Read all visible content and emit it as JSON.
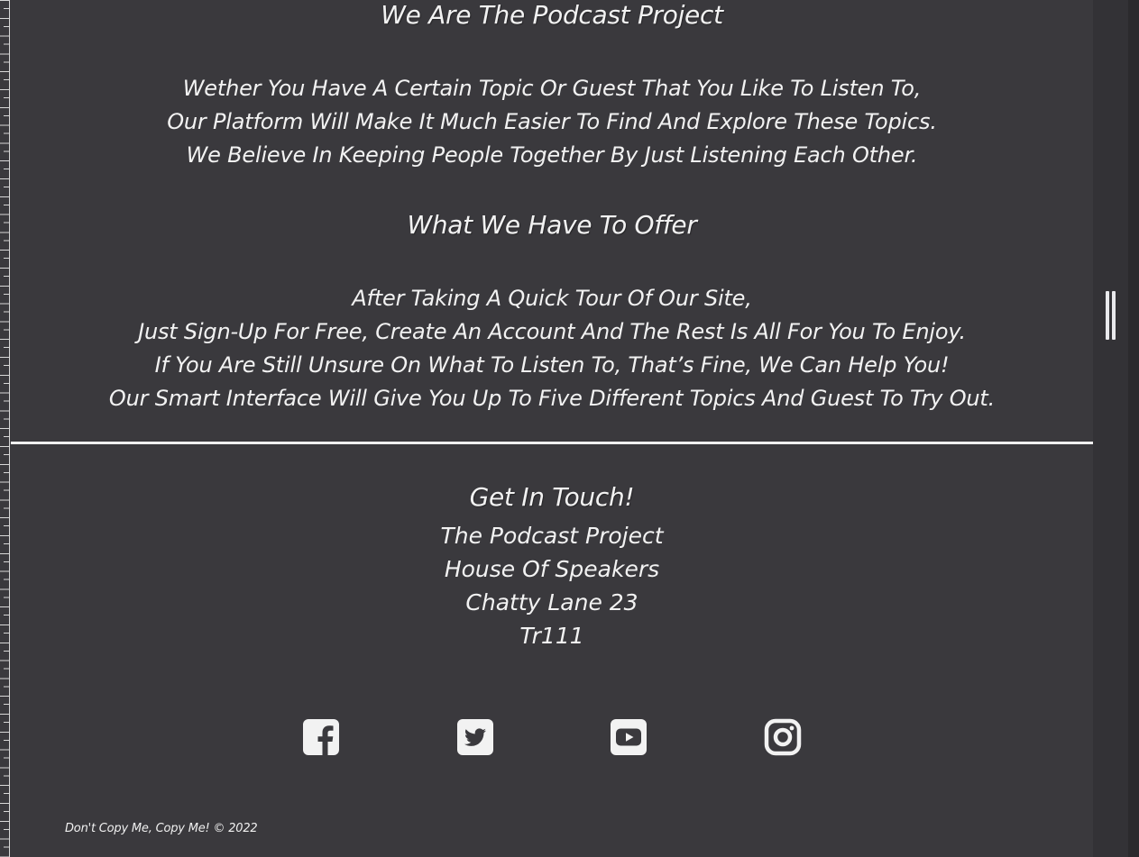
{
  "about": {
    "title": "We Are The Podcast Project",
    "lines": [
      "Wether You Have A Certain Topic Or Guest That You Like To Listen To,",
      "Our Platform Will Make It Much Easier To Find And Explore These Topics.",
      "We Believe In Keeping People Together By Just Listening Each Other."
    ]
  },
  "offer": {
    "title": "What We Have To Offer",
    "lines": [
      "After Taking A Quick Tour Of Our Site,",
      "Just Sign-Up For Free, Create An Account And The Rest Is All For You To Enjoy.",
      "If You Are Still Unsure On What To Listen To, That’s Fine, We Can Help You!",
      "Our Smart Interface Will Give You Up To Five Different Topics And Guest To Try Out."
    ]
  },
  "contact": {
    "title": "Get In Touch!",
    "lines": [
      "The Podcast Project",
      "House Of Speakers",
      "Chatty Lane 23",
      "Tr111"
    ]
  },
  "socials": [
    {
      "icon": "facebook-icon"
    },
    {
      "icon": "twitter-icon"
    },
    {
      "icon": "youtube-icon"
    },
    {
      "icon": "instagram-icon"
    }
  ],
  "footer": {
    "copyright": "Don't Copy Me, Copy Me! © 2022"
  },
  "colors": {
    "background": "#3a393d",
    "text": "#f2f2f2",
    "panel": "#333236"
  }
}
